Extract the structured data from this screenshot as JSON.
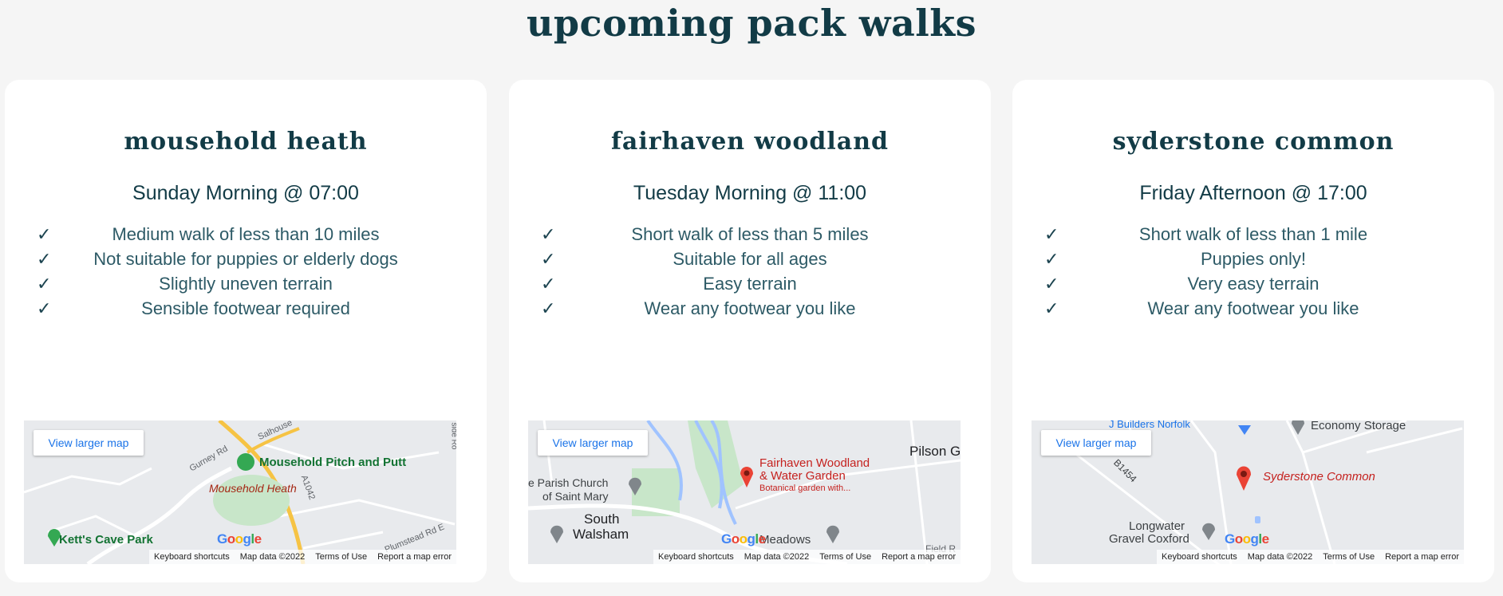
{
  "page": {
    "title": "upcoming pack walks"
  },
  "cards": [
    {
      "title": "mousehold heath",
      "time": "Sunday Morning @ 07:00",
      "features": [
        "Medium walk of less than 10 miles",
        "Not suitable for puppies or elderly dogs",
        "Slightly uneven terrain",
        "Sensible footwear required"
      ],
      "map": {
        "button": "View larger map",
        "labels": [
          "Mousehold Pitch and Putt",
          "Mousehold Heath",
          "Kett's Cave Park",
          "Gurney Rd",
          "A1042",
          "Salhouse",
          "Plumstead Rd E",
          "side Ro"
        ],
        "attribution": [
          "Keyboard shortcuts",
          "Map data ©2022",
          "Terms of Use",
          "Report a map error"
        ]
      }
    },
    {
      "title": "fairhaven woodland",
      "time": "Tuesday Morning @ 11:00",
      "features": [
        "Short walk of less than 5 miles",
        "Suitable for all ages",
        "Easy terrain",
        "Wear any footwear you like"
      ],
      "map": {
        "button": "View larger map",
        "labels": [
          "Fairhaven Woodland",
          "& Water Garden",
          "Botanical garden with...",
          "e Parish Church",
          "of Saint Mary",
          "South",
          "Walsham",
          "Pilson G",
          "Meadows",
          "Field R"
        ],
        "attribution": [
          "Keyboard shortcuts",
          "Map data ©2022",
          "Terms of Use",
          "Report a map error"
        ]
      }
    },
    {
      "title": "syderstone common",
      "time": "Friday Afternoon @ 17:00",
      "features": [
        "Short walk of less than 1 mile",
        "Puppies only!",
        "Very easy terrain",
        "Wear any footwear you like"
      ],
      "map": {
        "button": "View larger map",
        "labels": [
          "Syderstone Common",
          "Economy Storage",
          "B1454",
          "Longwater",
          "Gravel Coxford",
          "J Builders Norfolk"
        ],
        "attribution": [
          "Keyboard shortcuts",
          "Map data ©2022",
          "Terms of Use",
          "Report a map error"
        ]
      }
    }
  ],
  "check_glyph": "✓",
  "google_logo": [
    "G",
    "o",
    "o",
    "g",
    "l",
    "e"
  ],
  "colors": {
    "heading": "#123b46",
    "text": "#2d5a66",
    "link": "#1a73e8",
    "pin": "#ea4335"
  }
}
